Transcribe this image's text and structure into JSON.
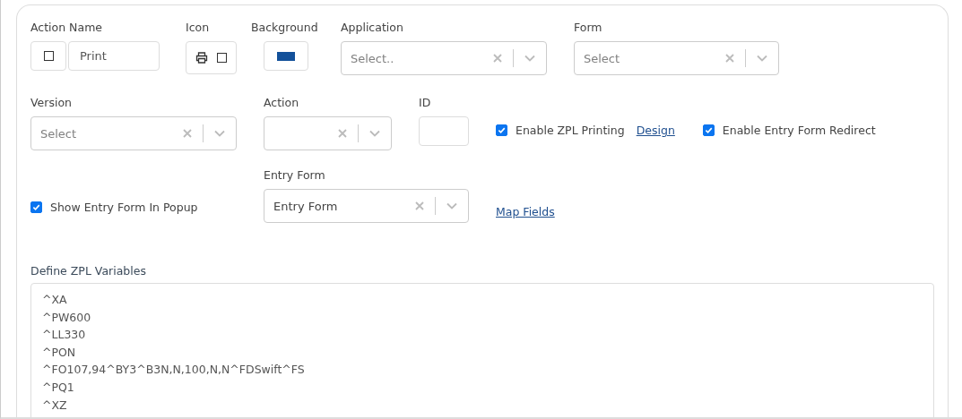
{
  "action_name": {
    "label": "Action Name",
    "checked": false,
    "value": "Print"
  },
  "icon": {
    "label": "Icon",
    "checked": false
  },
  "background": {
    "label": "Background",
    "color": "#13519a"
  },
  "application": {
    "label": "Application",
    "placeholder": "Select.."
  },
  "form": {
    "label": "Form",
    "placeholder": "Select"
  },
  "version": {
    "label": "Version",
    "placeholder": "Select"
  },
  "action": {
    "label": "Action"
  },
  "id": {
    "label": "ID"
  },
  "enable_zpl": {
    "label": "Enable ZPL Printing",
    "checked": true,
    "link": "Design"
  },
  "enable_redirect": {
    "label": "Enable Entry Form Redirect",
    "checked": true
  },
  "show_popup": {
    "label": "Show Entry Form In Popup",
    "checked": true
  },
  "entry_form": {
    "label": "Entry Form",
    "value": "Entry Form",
    "link": "Map Fields"
  },
  "zpl": {
    "label": "Define ZPL Variables",
    "lines": [
      "^XA",
      "^PW600",
      "^LL330",
      "^PON",
      "^FO107,94^BY3^B3N,N,100,N,N^FDSwift^FS",
      "^PQ1",
      "^XZ"
    ]
  }
}
